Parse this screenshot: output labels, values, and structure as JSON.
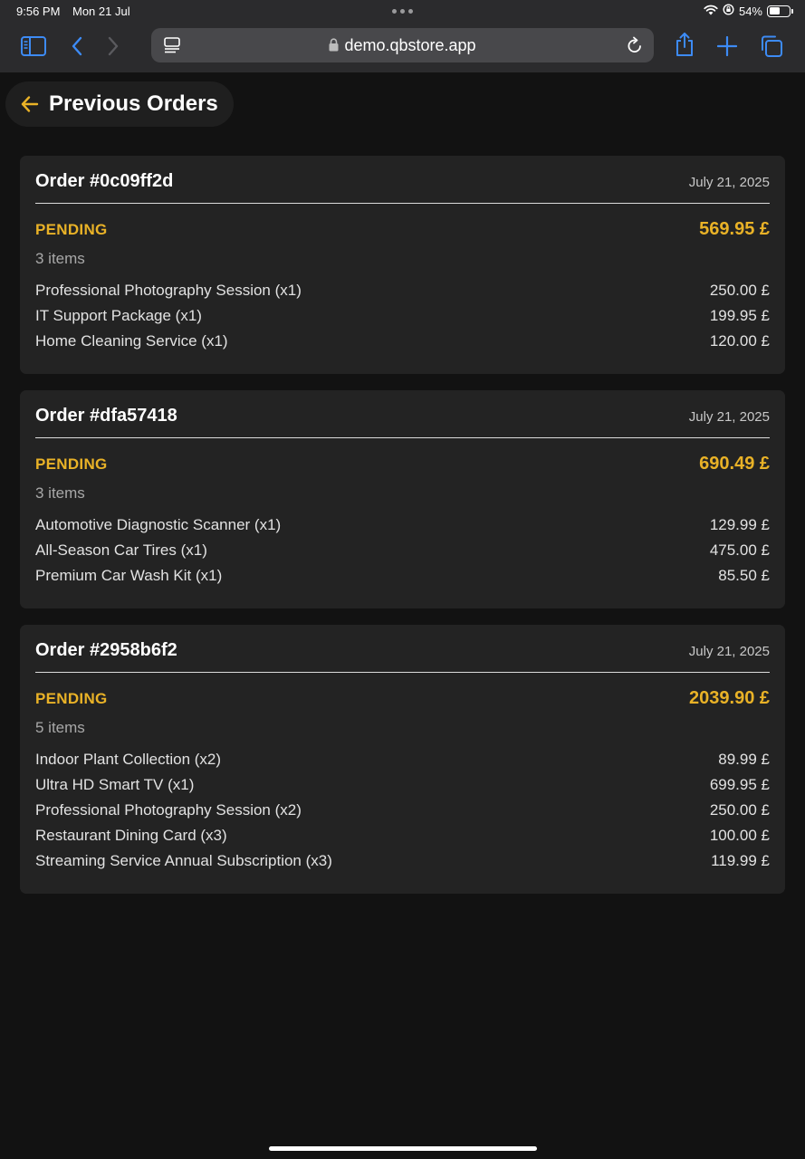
{
  "status_bar": {
    "time": "9:56 PM",
    "date": "Mon 21 Jul",
    "battery": "54%",
    "battery_level": 0.54
  },
  "browser": {
    "url": "demo.qbstore.app",
    "accent": "#3d8bf5"
  },
  "page": {
    "title": "Previous Orders",
    "accent": "#e9b227"
  },
  "orders": [
    {
      "title": "Order #0c09ff2d",
      "date": "July 21, 2025",
      "status": "PENDING",
      "total": "569.95 £",
      "count": "3 items",
      "items": [
        {
          "name": "Professional Photography Session (x1)",
          "price": "250.00 £"
        },
        {
          "name": "IT Support Package (x1)",
          "price": "199.95 £"
        },
        {
          "name": "Home Cleaning Service (x1)",
          "price": "120.00 £"
        }
      ]
    },
    {
      "title": "Order #dfa57418",
      "date": "July 21, 2025",
      "status": "PENDING",
      "total": "690.49 £",
      "count": "3 items",
      "items": [
        {
          "name": "Automotive Diagnostic Scanner (x1)",
          "price": "129.99 £"
        },
        {
          "name": "All-Season Car Tires (x1)",
          "price": "475.00 £"
        },
        {
          "name": "Premium Car Wash Kit (x1)",
          "price": "85.50 £"
        }
      ]
    },
    {
      "title": "Order #2958b6f2",
      "date": "July 21, 2025",
      "status": "PENDING",
      "total": "2039.90 £",
      "count": "5 items",
      "items": [
        {
          "name": "Indoor Plant Collection (x2)",
          "price": "89.99 £"
        },
        {
          "name": "Ultra HD Smart TV (x1)",
          "price": "699.95 £"
        },
        {
          "name": "Professional Photography Session (x2)",
          "price": "250.00 £"
        },
        {
          "name": "Restaurant Dining Card (x3)",
          "price": "100.00 £"
        },
        {
          "name": "Streaming Service Annual Subscription (x3)",
          "price": "119.99 £"
        }
      ]
    }
  ]
}
